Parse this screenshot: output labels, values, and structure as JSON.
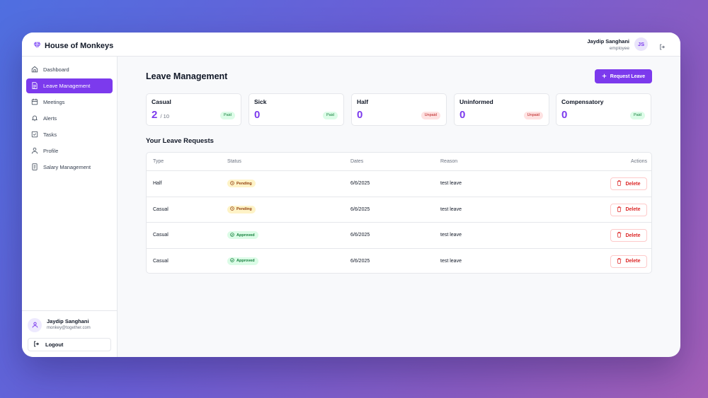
{
  "app": {
    "name": "House of Monkeys",
    "logo_icon": "diamond-icon",
    "accent": "#7c3aed"
  },
  "header": {
    "user_name": "Jaydip Sanghani",
    "user_role": "employee",
    "avatar_initials": "JS",
    "logout_icon": "logout-icon"
  },
  "sidebar": {
    "items": [
      {
        "label": "Dashboard",
        "icon": "home-icon",
        "active": false
      },
      {
        "label": "Leave Management",
        "icon": "document-icon",
        "active": true
      },
      {
        "label": "Meetings",
        "icon": "calendar-icon",
        "active": false
      },
      {
        "label": "Alerts",
        "icon": "bell-icon",
        "active": false
      },
      {
        "label": "Tasks",
        "icon": "checkbox-icon",
        "active": false
      },
      {
        "label": "Profile",
        "icon": "user-icon",
        "active": false
      },
      {
        "label": "Salary Management",
        "icon": "receipt-icon",
        "active": false
      }
    ],
    "user": {
      "name": "Jaydip Sanghani",
      "email": "monkey@together.com"
    },
    "logout_label": "Logout"
  },
  "main": {
    "title": "Leave Management",
    "request_button": "Request Leave",
    "cards": [
      {
        "title": "Casual",
        "value": "2",
        "total": "/ 10",
        "badge": "Paid",
        "badge_type": "paid"
      },
      {
        "title": "Sick",
        "value": "0",
        "total": "",
        "badge": "Paid",
        "badge_type": "paid"
      },
      {
        "title": "Half",
        "value": "0",
        "total": "",
        "badge": "Unpaid",
        "badge_type": "unpaid"
      },
      {
        "title": "Uninformed",
        "value": "0",
        "total": "",
        "badge": "Unpaid",
        "badge_type": "unpaid"
      },
      {
        "title": "Compensatory",
        "value": "0",
        "total": "",
        "badge": "Paid",
        "badge_type": "paid"
      }
    ],
    "requests_title": "Your Leave Requests",
    "table": {
      "headers": {
        "type": "Type",
        "status": "Status",
        "dates": "Dates",
        "reason": "Reason",
        "actions": "Actions"
      },
      "rows": [
        {
          "type": "Half",
          "status": "Pending",
          "status_type": "pending",
          "dates": "6/6/2025",
          "reason": "test leave",
          "action": "Delete"
        },
        {
          "type": "Casual",
          "status": "Pending",
          "status_type": "pending",
          "dates": "6/6/2025",
          "reason": "test leave",
          "action": "Delete"
        },
        {
          "type": "Casual",
          "status": "Approved",
          "status_type": "approved",
          "dates": "6/6/2025",
          "reason": "test leave",
          "action": "Delete"
        },
        {
          "type": "Casual",
          "status": "Approved",
          "status_type": "approved",
          "dates": "6/6/2025",
          "reason": "test leave",
          "action": "Delete"
        }
      ]
    }
  }
}
